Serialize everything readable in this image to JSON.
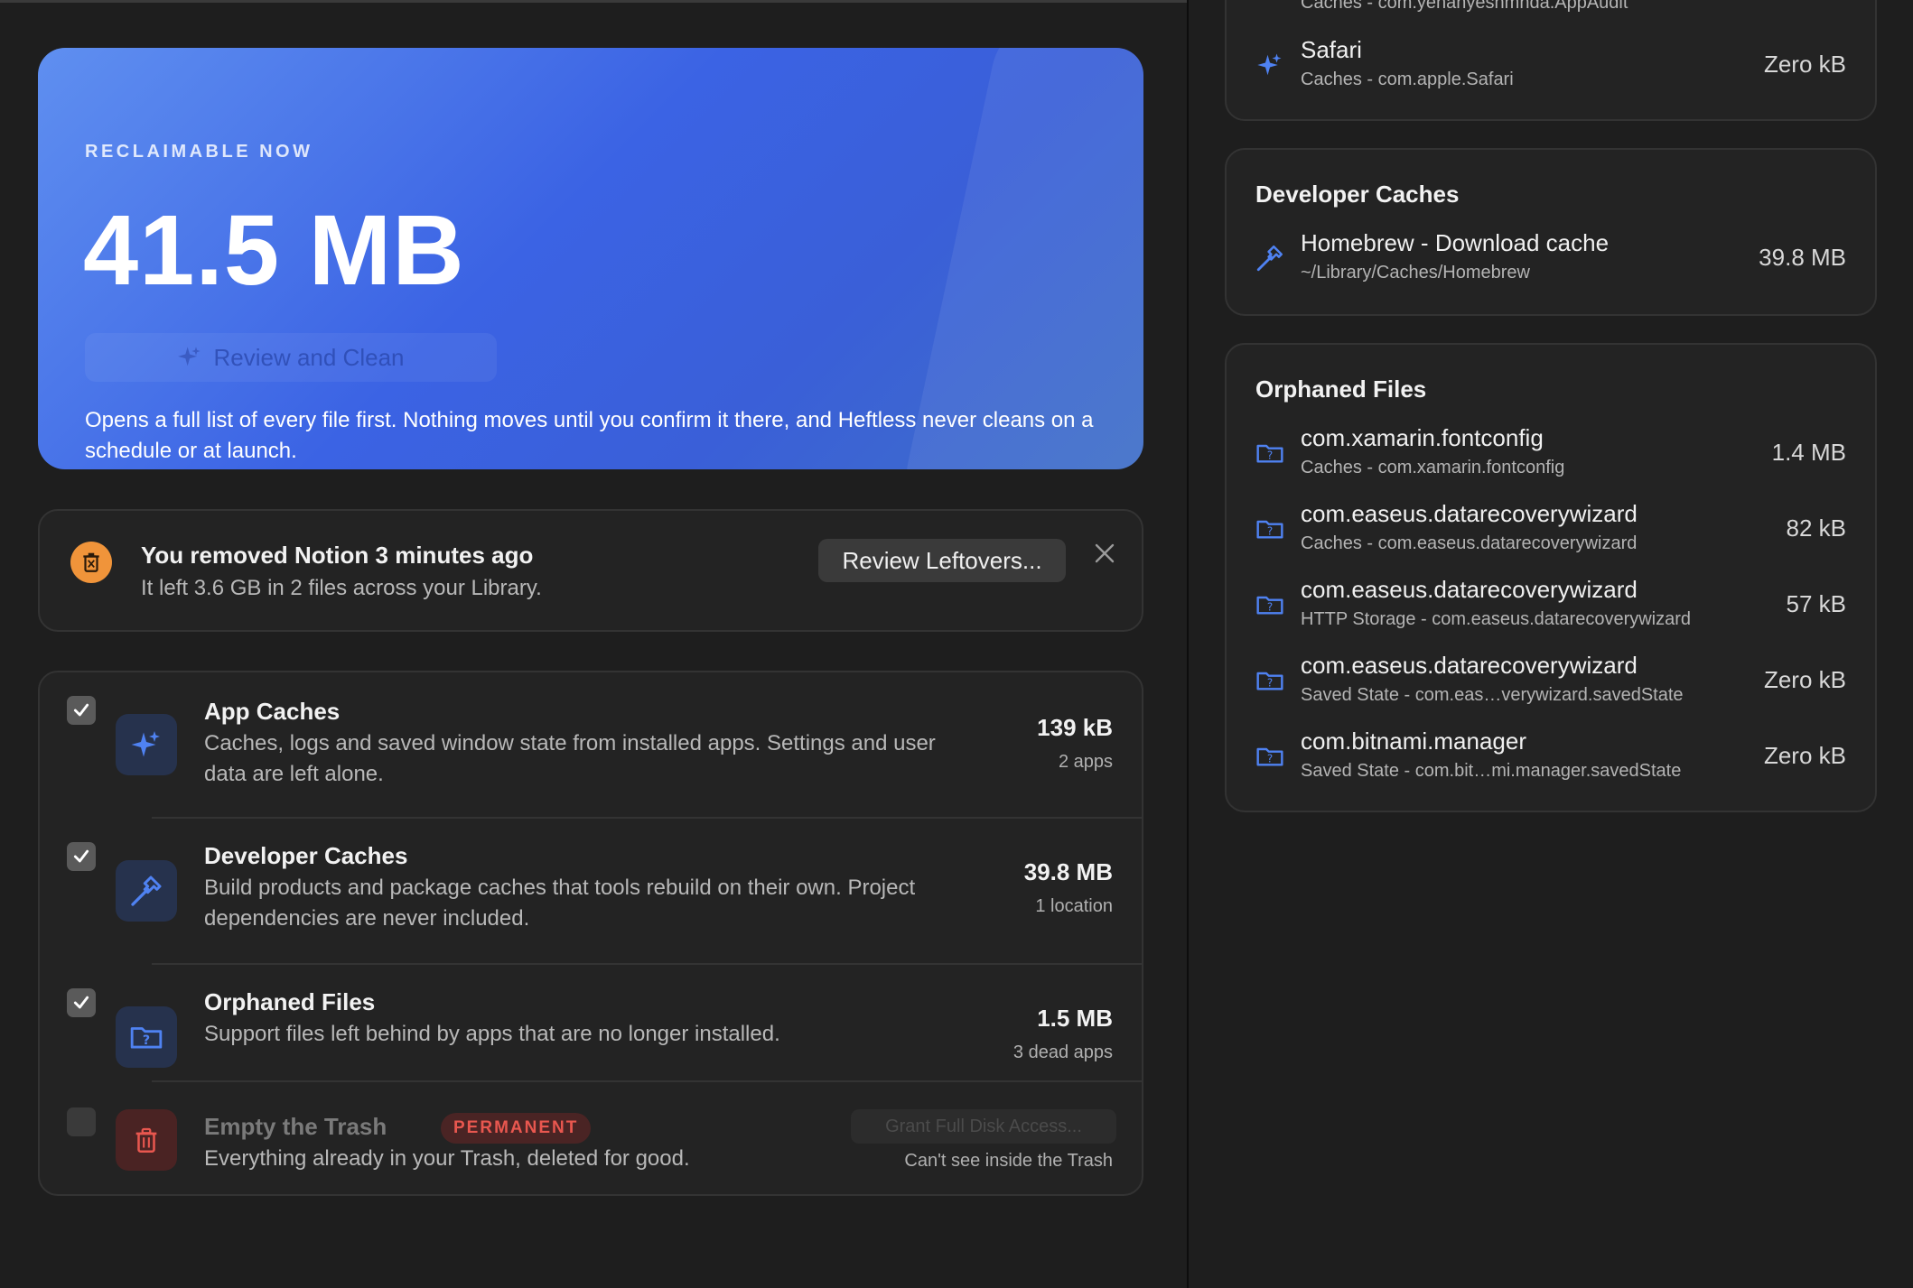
{
  "hero": {
    "eyebrow": "RECLAIMABLE NOW",
    "amount": "41.5 MB",
    "button_label": "Review and Clean",
    "description": "Opens a full list of every file first. Nothing moves until you confirm it there, and Heftless never cleans on a schedule or at launch."
  },
  "notice": {
    "title": "You removed Notion 3 minutes ago",
    "subtitle": "It left 3.6 GB in 2 files across your Library.",
    "button_label": "Review Leftovers...",
    "icon": "trash-app-icon"
  },
  "categories": [
    {
      "title": "App Caches",
      "description": "Caches, logs and saved window state from installed apps. Settings and user data are left alone.",
      "size": "139 kB",
      "count": "2 apps",
      "checked": true,
      "icon": "sparkle-icon"
    },
    {
      "title": "Developer Caches",
      "description": "Build products and package caches that tools rebuild on their own. Project dependencies are never included.",
      "size": "39.8 MB",
      "count": "1 location",
      "checked": true,
      "icon": "hammer-icon"
    },
    {
      "title": "Orphaned Files",
      "description": "Support files left behind by apps that are no longer installed.",
      "size": "1.5 MB",
      "count": "3 dead apps",
      "checked": true,
      "icon": "folder-question-icon"
    },
    {
      "title": "Empty the Trash",
      "badge": "PERMANENT",
      "description": "Everything already in your Trash, deleted for good.",
      "button_label": "Grant Full Disk Access...",
      "status": "Can't see inside the Trash",
      "checked": false,
      "icon": "trash-icon"
    }
  ],
  "app_caches_card": {
    "top_partial_path": "Caches - com.yehanyeshmnda.AppAudit",
    "items": [
      {
        "name": "Safari",
        "path": "Caches - com.apple.Safari",
        "size": "Zero kB"
      }
    ]
  },
  "developer_caches_card": {
    "title": "Developer Caches",
    "items": [
      {
        "name": "Homebrew - Download cache",
        "path": "~/Library/Caches/Homebrew",
        "size": "39.8 MB"
      }
    ]
  },
  "orphaned_files_card": {
    "title": "Orphaned Files",
    "items": [
      {
        "name": "com.xamarin.fontconfig",
        "path": "Caches - com.xamarin.fontconfig",
        "size": "1.4 MB"
      },
      {
        "name": "com.easeus.datarecoverywizard",
        "path": "Caches - com.easeus.datarecoverywizard",
        "size": "82 kB"
      },
      {
        "name": "com.easeus.datarecoverywizard",
        "path": "HTTP Storage - com.easeus.datarecoverywizard",
        "size": "57 kB"
      },
      {
        "name": "com.easeus.datarecoverywizard",
        "path": "Saved State - com.eas…verywizard.savedState",
        "size": "Zero kB"
      },
      {
        "name": "com.bitnami.manager",
        "path": "Saved State - com.bit…mi.manager.savedState",
        "size": "Zero kB"
      }
    ]
  },
  "colors": {
    "accent": "#3b63e4",
    "icon_blue": "#4f82f2",
    "danger": "#e8574f",
    "warning": "#f0943a"
  }
}
